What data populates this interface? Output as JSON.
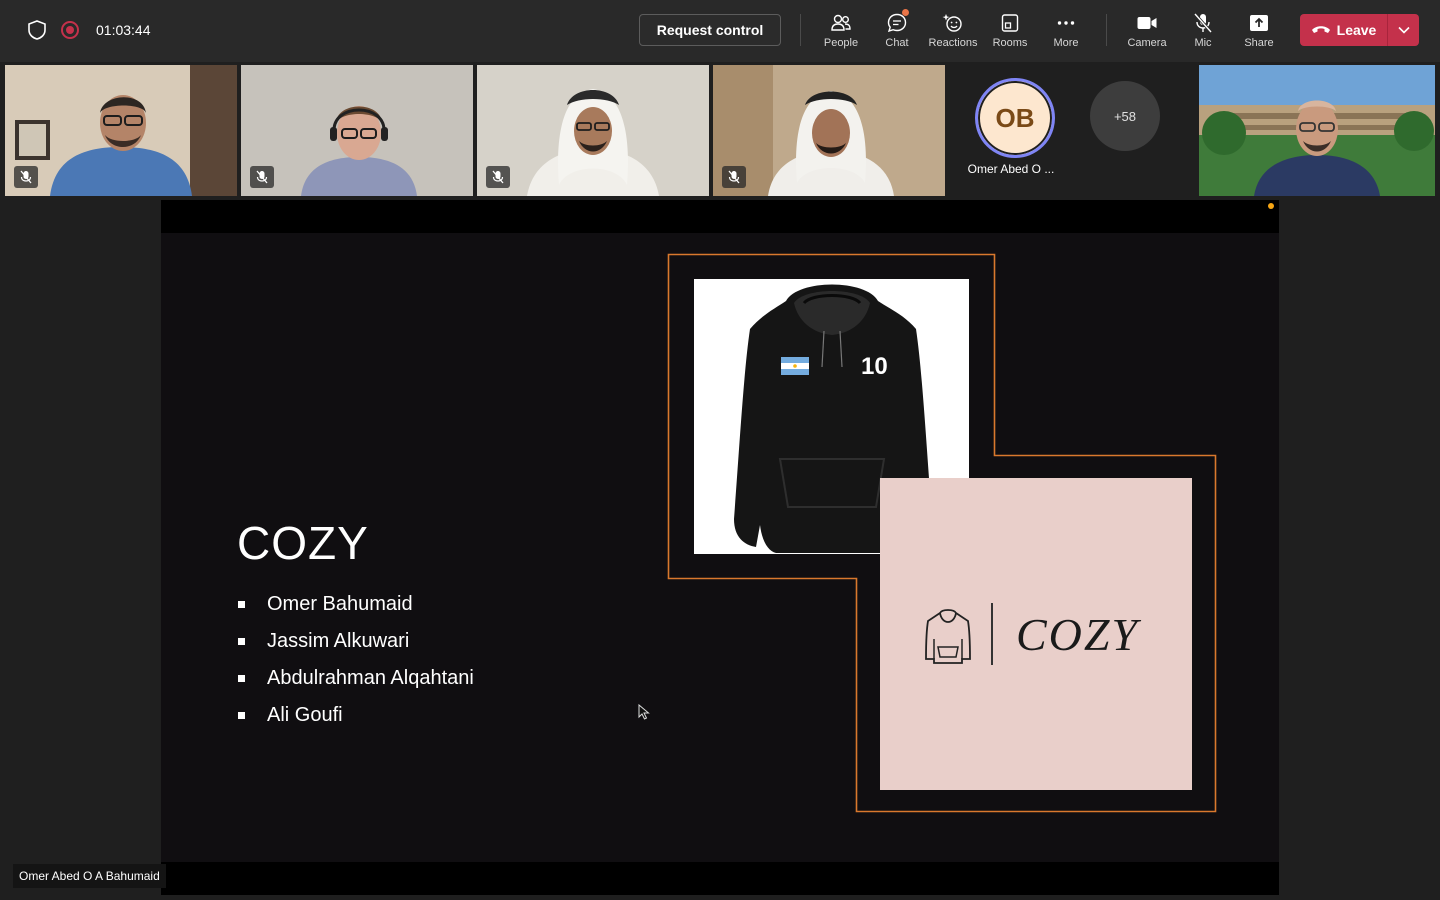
{
  "header": {
    "timer": "01:03:44",
    "request_control_label": "Request control",
    "tools": [
      {
        "name": "people",
        "label": "People",
        "icon": "people-icon"
      },
      {
        "name": "chat",
        "label": "Chat",
        "icon": "chat-icon"
      },
      {
        "name": "reactions",
        "label": "Reactions",
        "icon": "reactions-icon"
      },
      {
        "name": "rooms",
        "label": "Rooms",
        "icon": "rooms-icon"
      },
      {
        "name": "more",
        "label": "More",
        "icon": "more-icon"
      },
      {
        "name": "camera",
        "label": "Camera",
        "icon": "camera-icon"
      },
      {
        "name": "mic",
        "label": "Mic",
        "icon": "mic-off-icon"
      },
      {
        "name": "share",
        "label": "Share",
        "icon": "share-icon"
      }
    ],
    "leave_label": "Leave"
  },
  "participants": {
    "avatar_initials": "OB",
    "avatar_name": "Omer Abed O ...",
    "overflow_count": "+58"
  },
  "slide": {
    "title": "COZY",
    "members": [
      "Omer Bahumaid",
      "Jassim Alkuwari",
      "Abdulrahman Alqahtani",
      "Ali Goufi"
    ],
    "hoodie_number": "10",
    "logo_text": "COZY"
  },
  "presenter_name": "Omer Abed O A Bahumaid",
  "colors": {
    "leave": "#c4314b",
    "accent_frame": "#d9782d",
    "avatar_ring": "#7f85f5",
    "logo_bg": "#e9cfca"
  }
}
